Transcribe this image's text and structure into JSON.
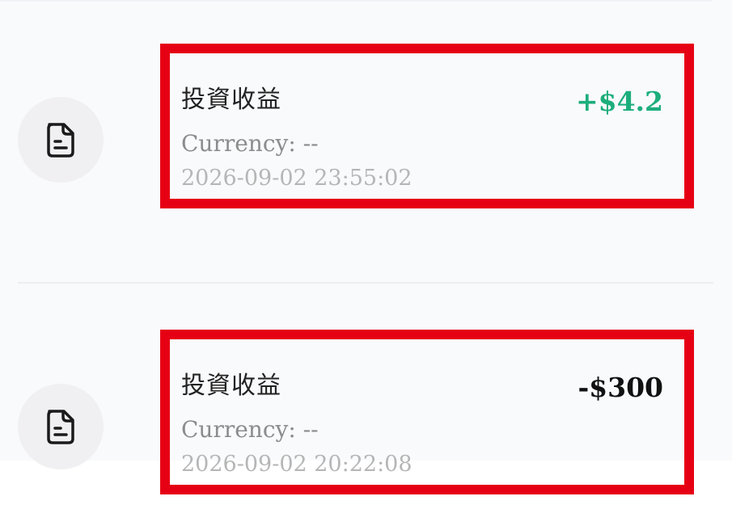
{
  "transactions": [
    {
      "title": "投資收益",
      "amount": "+$4.2",
      "direction": "credit",
      "currency_text": "Currency: --",
      "datetime": "2026-09-02 23:55:02",
      "icon": "document-icon"
    },
    {
      "title": "投資收益",
      "amount": "-$300",
      "direction": "debit",
      "currency_text": "Currency: --",
      "datetime": "2026-09-02 20:22:08",
      "icon": "document-icon"
    }
  ],
  "colors": {
    "highlight_border": "#e60014",
    "credit_amount": "#1dae7c",
    "debit_amount": "#111111",
    "background": "#f9fafc"
  }
}
